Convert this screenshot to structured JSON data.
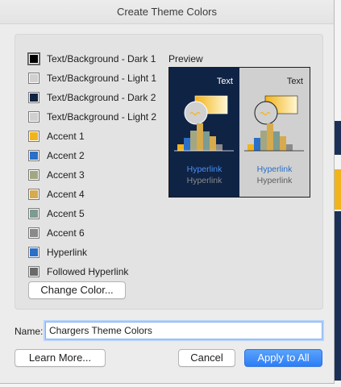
{
  "dialog": {
    "title": "Create Theme Colors"
  },
  "colors": [
    {
      "label": "Text/Background - Dark 1",
      "hex": "#000000",
      "selected": true
    },
    {
      "label": "Text/Background - Light 1",
      "hex": "#d0d0d0"
    },
    {
      "label": "Text/Background - Dark 2",
      "hex": "#0f2345"
    },
    {
      "label": "Text/Background - Light 2",
      "hex": "#d0d0d0"
    },
    {
      "label": "Accent 1",
      "hex": "#f2b41b"
    },
    {
      "label": "Accent 2",
      "hex": "#2a6fc8"
    },
    {
      "label": "Accent 3",
      "hex": "#a3a682"
    },
    {
      "label": "Accent 4",
      "hex": "#d6aa4d"
    },
    {
      "label": "Accent 5",
      "hex": "#7c9b92"
    },
    {
      "label": "Accent 6",
      "hex": "#8c8a88"
    },
    {
      "label": "Hyperlink",
      "hex": "#2a6fc8"
    },
    {
      "label": "Followed Hyperlink",
      "hex": "#6a6a6a"
    }
  ],
  "buttons": {
    "change_color": "Change Color...",
    "learn_more": "Learn More...",
    "cancel": "Cancel",
    "apply_to_all": "Apply to All"
  },
  "preview": {
    "label": "Preview",
    "text": "Text",
    "hyperlink": "Hyperlink",
    "followed": "Hyperlink",
    "dark_bg": "#0f2345",
    "light_bg": "#d0d0d0",
    "hyperlink_dark": "#4b8ff0",
    "hyperlink_light": "#2a6fc8",
    "followed_dark": "#8a8a8a",
    "followed_light": "#5e5e5e"
  },
  "name": {
    "label": "Name:",
    "value": "Chargers Theme Colors"
  }
}
